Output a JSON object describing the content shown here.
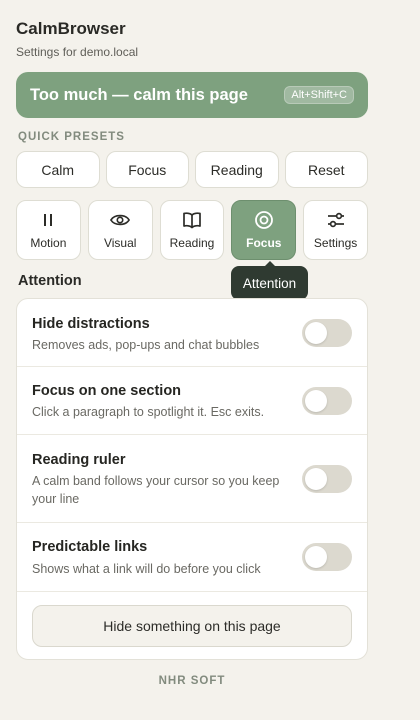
{
  "header": {
    "title": "CalmBrowser",
    "subtitle": "Settings for demo.local"
  },
  "calm_button": {
    "label": "Too much — calm this page",
    "shortcut": "Alt+Shift+C"
  },
  "presets": {
    "section_label": "QUICK PRESETS",
    "items": [
      {
        "label": "Calm"
      },
      {
        "label": "Focus"
      },
      {
        "label": "Reading"
      },
      {
        "label": "Reset"
      }
    ]
  },
  "tabs": {
    "active": "Focus",
    "items": [
      {
        "label": "Motion",
        "icon": "pause-icon"
      },
      {
        "label": "Visual",
        "icon": "eye-icon"
      },
      {
        "label": "Reading",
        "icon": "book-icon"
      },
      {
        "label": "Focus",
        "icon": "target-icon"
      },
      {
        "label": "Settings",
        "icon": "sliders-icon"
      }
    ]
  },
  "tooltip": {
    "text": "Attention"
  },
  "attention": {
    "group_title": "Attention",
    "settings": [
      {
        "title": "Hide distractions",
        "description": "Removes ads, pop-ups and chat bubbles",
        "enabled": false
      },
      {
        "title": "Focus on one section",
        "description": "Click a paragraph to spotlight it. Esc exits.",
        "enabled": false
      },
      {
        "title": "Reading ruler",
        "description": "A calm band follows your cursor so you keep your line",
        "enabled": false
      },
      {
        "title": "Predictable links",
        "description": "Shows what a link will do before you click",
        "enabled": false
      }
    ],
    "hide_button_label": "Hide something on this page"
  },
  "footer": {
    "text": "NHR SOFT"
  },
  "colors": {
    "accent": "#7ea17f",
    "background": "#f4f2ec",
    "tooltip": "#2f3a31",
    "toggle_off": "#dcd9cf"
  }
}
